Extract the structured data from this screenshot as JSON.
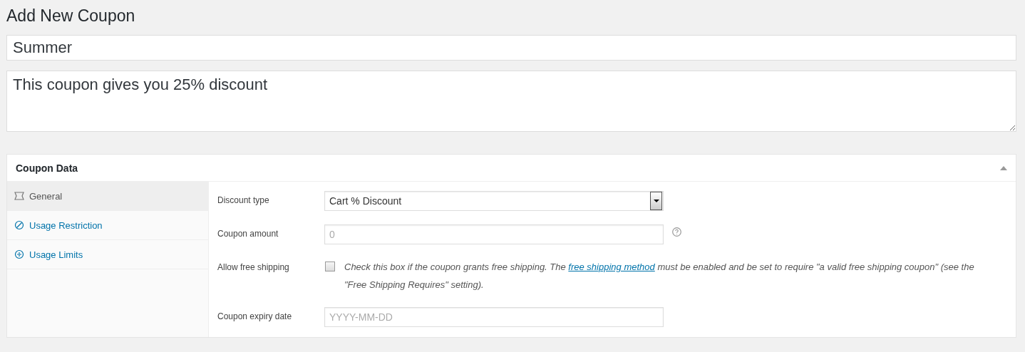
{
  "page_title": "Add New Coupon",
  "coupon_code": {
    "value": "Summer"
  },
  "description": {
    "value": "This coupon gives you 25% discount"
  },
  "panel": {
    "title": "Coupon Data",
    "expanded": true,
    "tabs": [
      {
        "label": "General",
        "kind": "ticket",
        "selected": true
      },
      {
        "label": "Usage Restriction",
        "kind": "ban",
        "selected": false
      },
      {
        "label": "Usage Limits",
        "kind": "limits",
        "selected": false
      }
    ],
    "fields": [
      {
        "kind": "select",
        "label": "Discount type",
        "value": "Cart % Discount"
      },
      {
        "kind": "text",
        "label": "Coupon amount",
        "placeholder": "0"
      },
      {
        "kind": "checkbox",
        "label": "Allow free shipping",
        "checked": false,
        "text_before": "Check this box if the coupon grants free shipping. The ",
        "link": "free shipping method",
        "text_after": " must be enabled and be set to require \"a valid free shipping coupon\" (see the \"Free Shipping Requires\" setting)."
      },
      {
        "kind": "date",
        "label": "Coupon expiry date",
        "placeholder": "YYYY-MM-DD"
      }
    ]
  }
}
